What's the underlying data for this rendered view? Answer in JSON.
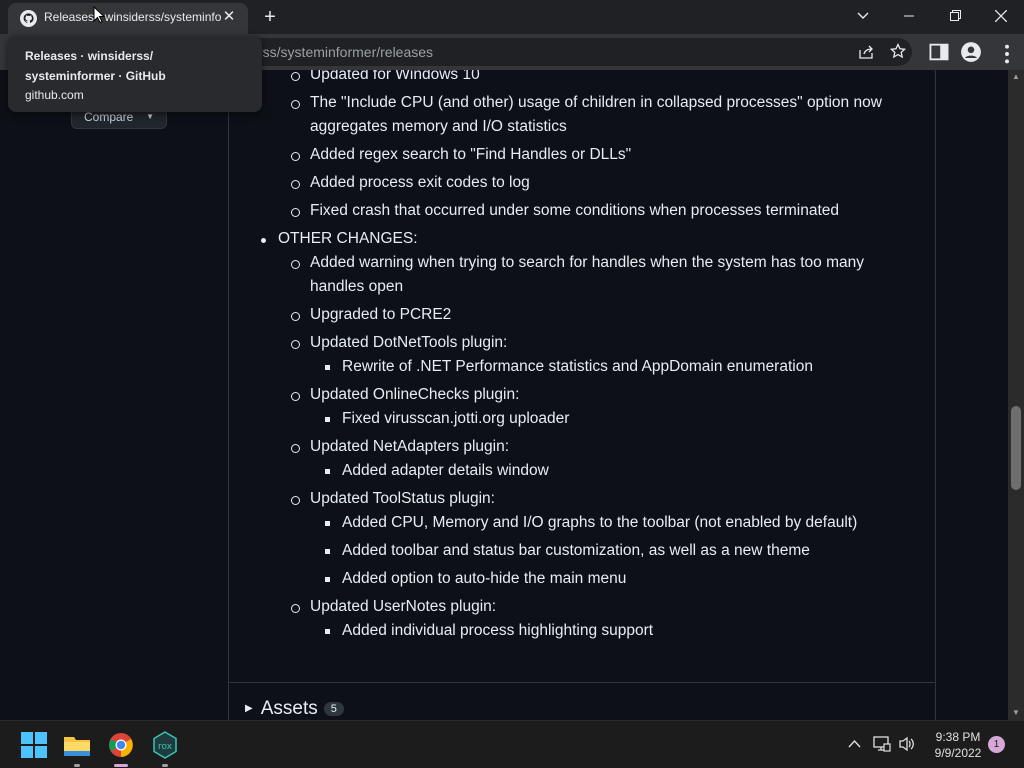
{
  "browser": {
    "tab_title": "Releases · winsiderss/systeminformer",
    "tab_close": "✕",
    "new_tab": "+",
    "url": "rss/systeminformer/releases",
    "tooltip": {
      "title_line1": "Releases · winsiderss/",
      "title_line2": "systeminformer · GitHub",
      "host": "github.com"
    }
  },
  "page": {
    "compare_label": "Compare",
    "notes": [
      "Updated for Windows 10",
      "The \"Include CPU (and other) usage of children in collapsed processes\" option now",
      "aggregates memory and I/O statistics",
      "Added regex search to \"Find Handles or DLLs\"",
      "Added process exit codes to log",
      "Fixed crash that occurred under some conditions when processes terminated",
      "OTHER CHANGES:",
      "Added warning when trying to search for handles when the system has too many",
      "handles open",
      "Upgraded to PCRE2",
      "Updated DotNetTools plugin:",
      "Rewrite of .NET Performance statistics and AppDomain enumeration",
      "Updated OnlineChecks plugin:",
      "Fixed virusscan.jotti.org uploader",
      "Updated NetAdapters plugin:",
      "Added adapter details window",
      "Updated ToolStatus plugin:",
      "Added CPU, Memory and I/O graphs to the toolbar (not enabled by default)",
      "Added toolbar and status bar customization, as well as a new theme",
      "Added option to auto-hide the main menu",
      "Updated UserNotes plugin:",
      "Added individual process highlighting support"
    ],
    "assets_label": "Assets",
    "assets_count": "5"
  },
  "taskbar": {
    "time": "9:38 PM",
    "date": "9/9/2022",
    "notification_count": "1",
    "apps": [
      "start-icon",
      "file-explorer-icon",
      "chrome-icon",
      "rox-icon"
    ]
  },
  "colors": {
    "page_bg": "#0d1117",
    "text": "#e6edf3",
    "border": "#30363d",
    "chrome_bar": "#202124",
    "chrome_toolbar": "#35363a"
  }
}
